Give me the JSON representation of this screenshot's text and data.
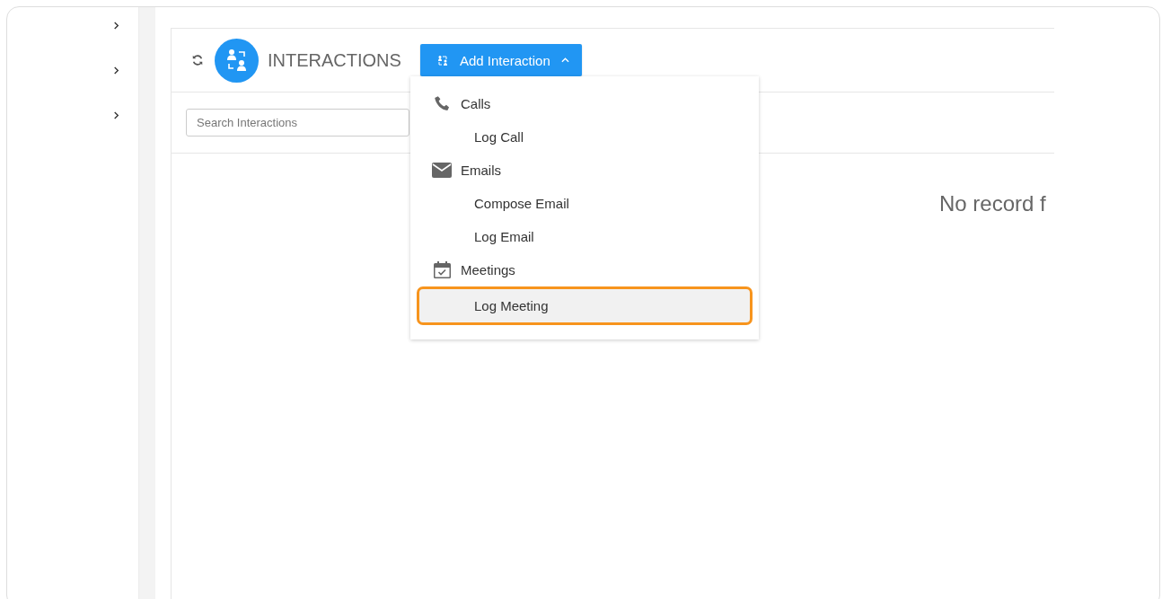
{
  "sidebar": {
    "items": [
      {
        "expanded": false
      },
      {
        "expanded": false
      },
      {
        "expanded": false
      }
    ]
  },
  "panel": {
    "title": "INTERACTIONS",
    "add_button": {
      "label": "Add Interaction",
      "expanded": true
    },
    "search": {
      "placeholder": "Search Interactions"
    },
    "empty_message": "No record f"
  },
  "menu": {
    "groups": [
      {
        "label": "Calls",
        "items": [
          {
            "label": "Log Call",
            "selected": false
          }
        ]
      },
      {
        "label": "Emails",
        "items": [
          {
            "label": "Compose Email",
            "selected": false
          },
          {
            "label": "Log Email",
            "selected": false
          }
        ]
      },
      {
        "label": "Meetings",
        "items": [
          {
            "label": "Log Meeting",
            "selected": true
          }
        ]
      }
    ]
  }
}
